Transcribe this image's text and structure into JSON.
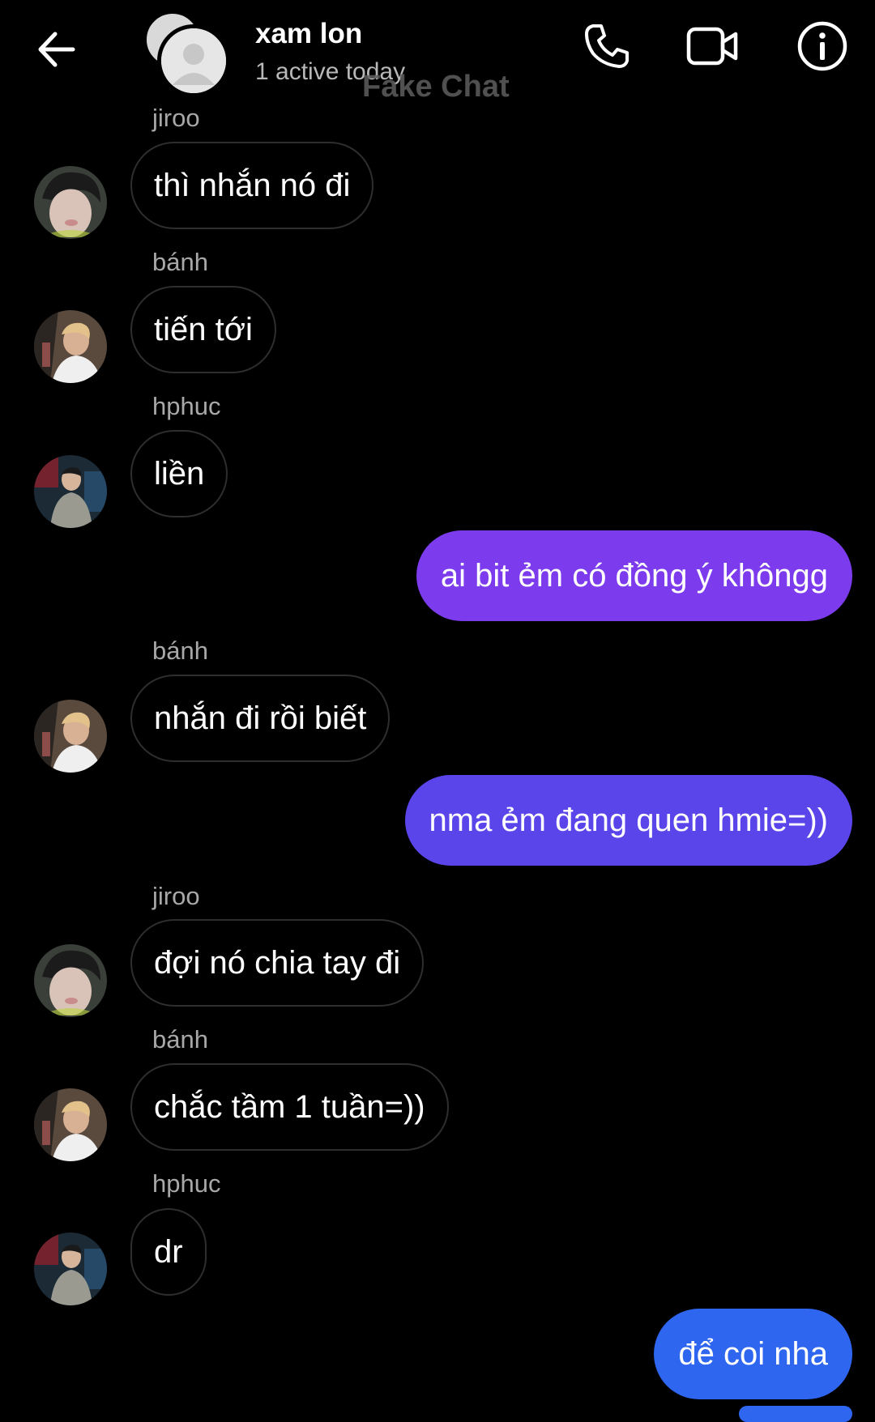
{
  "header": {
    "title": "xam lon",
    "subtitle": "1 active today",
    "watermark": "Fake Chat",
    "icons": [
      "back-arrow-icon",
      "group-avatar-icon",
      "phone-icon",
      "video-camera-icon",
      "info-icon"
    ]
  },
  "colors": {
    "background": "#000000",
    "incoming_border": "#2e2e2e",
    "outgoing_purple": "#7c3ced",
    "outgoing_indigo": "#5a45ea",
    "outgoing_blue": "#2f66f0"
  },
  "messages": [
    {
      "sender": "jiroo",
      "text": "thì nhắn nó đi"
    },
    {
      "sender": "bánh",
      "text": "tiến tới"
    },
    {
      "sender": "hphuc",
      "text": "liền"
    },
    {
      "text": "ai bit ẻm có đồng ý khôngg"
    },
    {
      "sender": "bánh",
      "text": "nhắn đi rồi biết"
    },
    {
      "text": "nma ẻm đang quen hmie=))"
    },
    {
      "sender": "jiroo",
      "text": "đợi nó chia tay đi"
    },
    {
      "sender": "bánh",
      "text": "chắc tầm 1 tuần=))"
    },
    {
      "sender": "hphuc",
      "text": "dr"
    },
    {
      "text": "để coi nha"
    }
  ]
}
